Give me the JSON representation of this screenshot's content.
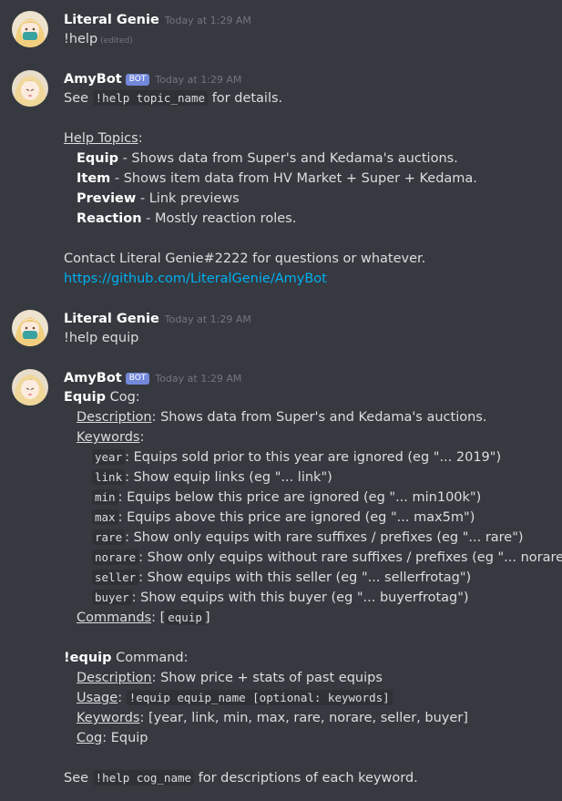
{
  "messages": [
    {
      "author": "Literal Genie",
      "timestamp": "Today at 1:29 AM",
      "text": "!help",
      "edited": "(edited)"
    },
    {
      "author": "AmyBot",
      "bot_tag": "BOT",
      "timestamp": "Today at 1:29 AM",
      "see_prefix": "See",
      "see_code": "!help topic_name",
      "see_suffix": "for details.",
      "topics_label": "Help Topics",
      "topics_colon": ":",
      "topics": [
        {
          "name": "Equip",
          "desc": " - Shows data from Super's and Kedama's auctions."
        },
        {
          "name": "Item",
          "desc": " - Shows item data from HV Market + Super + Kedama."
        },
        {
          "name": "Preview",
          "desc": " - Link previews"
        },
        {
          "name": "Reaction",
          "desc": " - Mostly reaction roles."
        }
      ],
      "contact": "Contact Literal Genie#2222 for questions or whatever.",
      "link": "https://github.com/LiteralGenie/AmyBot"
    },
    {
      "author": "Literal Genie",
      "timestamp": "Today at 1:29 AM",
      "text": "!help equip"
    },
    {
      "author": "AmyBot",
      "bot_tag": "BOT",
      "timestamp": "Today at 1:29 AM",
      "cog_title_bold": "Equip",
      "cog_title_rest": " Cog:",
      "description_label": "Description",
      "description_text": ": Shows data from Super's and Kedama's auctions.",
      "keywords_label": "Keywords",
      "keywords_colon": ":",
      "keywords": [
        {
          "key": "year",
          "desc": ": Equips sold prior to this year are ignored (eg \"... 2019\")"
        },
        {
          "key": "link",
          "desc": ": Show equip links (eg \"... link\")"
        },
        {
          "key": "min",
          "desc": ": Equips below this price are ignored (eg \"... min100k\")"
        },
        {
          "key": "max",
          "desc": ": Equips above this price are ignored (eg \"... max5m\")"
        },
        {
          "key": "rare",
          "desc": ": Show only equips with rare suffixes / prefixes (eg \"... rare\")"
        },
        {
          "key": "norare",
          "desc": ": Show only equips without rare suffixes / prefixes (eg \"... norare\")"
        },
        {
          "key": "seller",
          "desc": ": Show equips with this seller (eg \"... sellerfrotag\")"
        },
        {
          "key": "buyer",
          "desc": ": Show equips with this buyer (eg \"... buyerfrotag\")"
        }
      ],
      "commands_label": "Commands",
      "commands_pre": ": [",
      "commands_code": "equip",
      "commands_post": "]",
      "cmd_title_bold": "!equip",
      "cmd_title_rest": " Command:",
      "cmd_description_label": "Description",
      "cmd_description_text": ": Show price + stats of past equips",
      "usage_label": "Usage",
      "usage_colon": ":",
      "usage_code": "!equip equip_name [optional: keywords]",
      "cmd_keywords_label": "Keywords",
      "cmd_keywords_text": ": [year, link, min, max, rare, norare, seller, buyer]",
      "cog_label": "Cog",
      "cog_text": ": Equip",
      "footer_prefix": "See",
      "footer_code": "!help cog_name",
      "footer_suffix": "for descriptions of each keyword."
    }
  ]
}
